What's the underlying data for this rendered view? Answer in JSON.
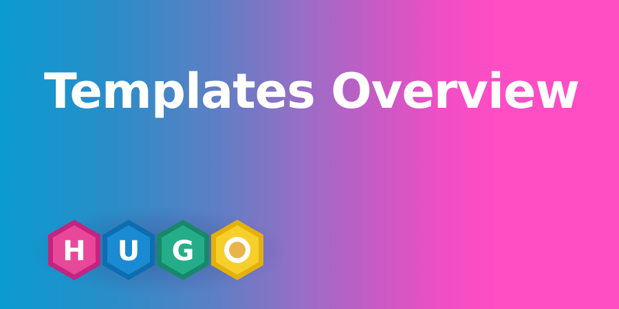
{
  "banner": {
    "title": "Templates Overview"
  },
  "logo": {
    "letters": [
      "H",
      "U",
      "G",
      "O"
    ],
    "colors": {
      "h_outer": "#c2247f",
      "h_inner": "#e8479a",
      "u_outer": "#0e6db0",
      "u_inner": "#1a8ad2",
      "g_outer": "#16896a",
      "g_inner": "#25ad89",
      "o_outer": "#e2b20a",
      "o_inner": "#f6cf2a",
      "o_center": "#e9b54a"
    }
  }
}
